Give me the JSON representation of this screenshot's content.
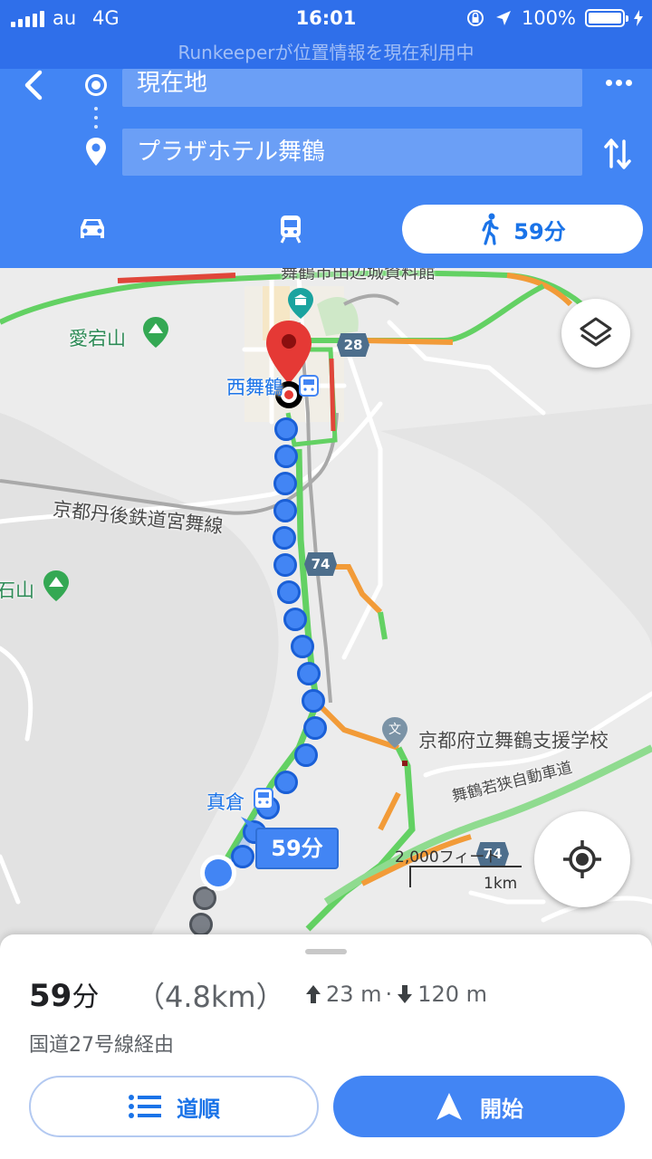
{
  "status_bar": {
    "carrier": "au",
    "network": "4G",
    "time": "16:01",
    "battery": "100%",
    "banner": "Runkeeperが位置情報を現在利用中"
  },
  "header": {
    "origin": "現在地",
    "destination": "プラザホテル舞鶴",
    "modes": {
      "walk_time": "59分"
    }
  },
  "map": {
    "labels": {
      "museum": "舞鶴市田辺城資料館",
      "atago": "愛宕山",
      "nishimaizuru": "西舞鶴",
      "railway": "京都丹後鉄道宮舞線",
      "ishiyama": "石山",
      "school": "京都府立舞鶴支援学校",
      "magura": "真倉",
      "expressway": "舞鶴若狭自動車道"
    },
    "shields": {
      "r28": "28",
      "r74a": "74",
      "r74b": "74"
    },
    "duration_bubble": "59分",
    "scale": {
      "imperial": "2,000フィート",
      "metric": "1km"
    },
    "colors": {
      "route": "#4285f4",
      "traffic_green": "#63d163",
      "traffic_orange": "#f29b38",
      "traffic_red": "#e0463a",
      "pin": "#e53935"
    }
  },
  "summary": {
    "time_value": "59",
    "time_unit": "分",
    "distance": "（4.8km）",
    "elevation_up": "23 m",
    "separator": "·",
    "elevation_down": "120 m",
    "via": "国道27号線経由"
  },
  "buttons": {
    "steps": "道順",
    "start": "開始"
  }
}
